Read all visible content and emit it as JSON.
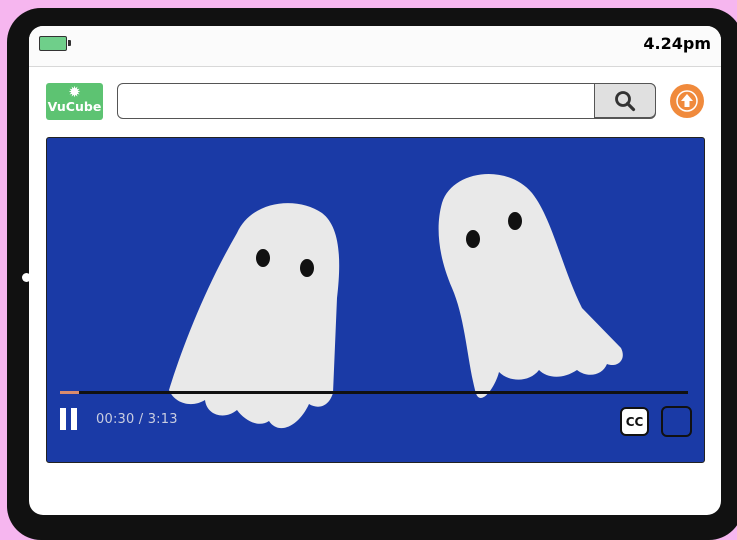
{
  "status_bar": {
    "time": "4.24pm",
    "battery_color": "#6fcf8a"
  },
  "app": {
    "logo_text": "VuCube",
    "logo_icon": "sun-star-icon",
    "logo_color": "#5dc372"
  },
  "search": {
    "value": "",
    "placeholder": "",
    "button_icon": "search-icon"
  },
  "upload": {
    "icon": "arrow-up-icon",
    "color": "#f08a3c"
  },
  "player": {
    "background_color": "#1a3aa6",
    "current_time": "00:30",
    "duration": "3:13",
    "time_display": "00:30 / 3:13",
    "progress_fraction": 0.03,
    "progress_color": "#d98b6e",
    "state_icon": "pause-icon",
    "captions_label": "CC",
    "fullscreen_icon": "fullscreen-icon"
  }
}
